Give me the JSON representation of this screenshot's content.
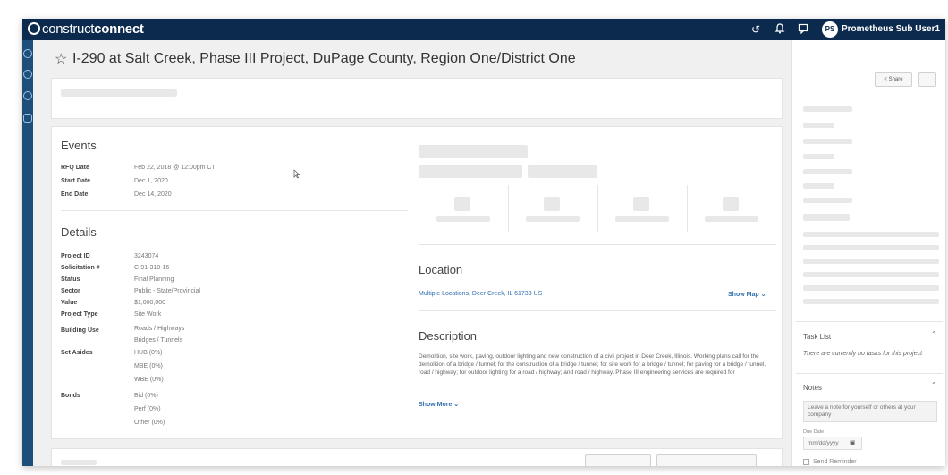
{
  "app": {
    "logo_light": "construct",
    "logo_bold": "connect",
    "user_initials": "PS",
    "user_name": "Prometheus Sub User1"
  },
  "icons": {
    "topbar": [
      "history-icon",
      "bell-icon",
      "chat-icon"
    ],
    "leftnav": [
      "dashboard-icon",
      "search-icon",
      "handshake-icon",
      "shield-icon"
    ]
  },
  "project": {
    "title": "I-290 at Salt Creek, Phase III Project, DuPage County, Region One/District One"
  },
  "events": {
    "heading": "Events",
    "rows": [
      {
        "label": "RFQ Date",
        "value": "Feb 22, 2018 @ 12:00pm CT"
      },
      {
        "label": "Start Date",
        "value": "Dec 1, 2020"
      },
      {
        "label": "End Date",
        "value": "Dec 14, 2020"
      }
    ]
  },
  "details": {
    "heading": "Details",
    "project_id_label": "Project ID",
    "project_id": "3243074",
    "solicitation_label": "Solicitation #",
    "solicitation": "C-91-318-16",
    "status_label": "Status",
    "status": "Final Planning",
    "sector_label": "Sector",
    "sector": "Public - State/Provincial",
    "value_label": "Value",
    "value": "$1,000,000",
    "project_type_label": "Project Type",
    "project_type": "Site Work",
    "building_use_label": "Building Use",
    "building_use": [
      "Roads / Highways",
      "Bridges / Tunnels"
    ],
    "set_asides_label": "Set Asides",
    "set_asides": [
      "HUB (0%)",
      "MBE (0%)",
      "WBE (0%)"
    ],
    "bonds_label": "Bonds",
    "bonds": [
      "Bid (0%)",
      "Perf (0%)",
      "Other (0%)"
    ]
  },
  "location": {
    "heading": "Location",
    "address": "Multiple Locations, Deer Creek, IL 61733 US",
    "show_map": "Show Map"
  },
  "description": {
    "heading": "Description",
    "text": "Demolition, site work, paving, outdoor lighting and new construction of a civil project in Deer Creek, Illinois. Working plans call for the demolition of a bridge / tunnel; for the construction of a bridge / tunnel; for site work for a bridge / tunnel; for paving for a bridge / tunnel, road / highway; for outdoor lighting for a road / highway; and road / highway. Phase III engineering services are required for",
    "show_more": "Show More"
  },
  "sidebar": {
    "share": "Share",
    "more": "…",
    "task_list_heading": "Task List",
    "task_list_empty": "There are currently no tasks for this project",
    "notes_heading": "Notes",
    "notes_placeholder": "Leave a note for yourself or others at your company",
    "due_date_label": "Due Date",
    "due_date_placeholder": "mm/dd/yyyy",
    "send_reminder": "Send Reminder"
  }
}
